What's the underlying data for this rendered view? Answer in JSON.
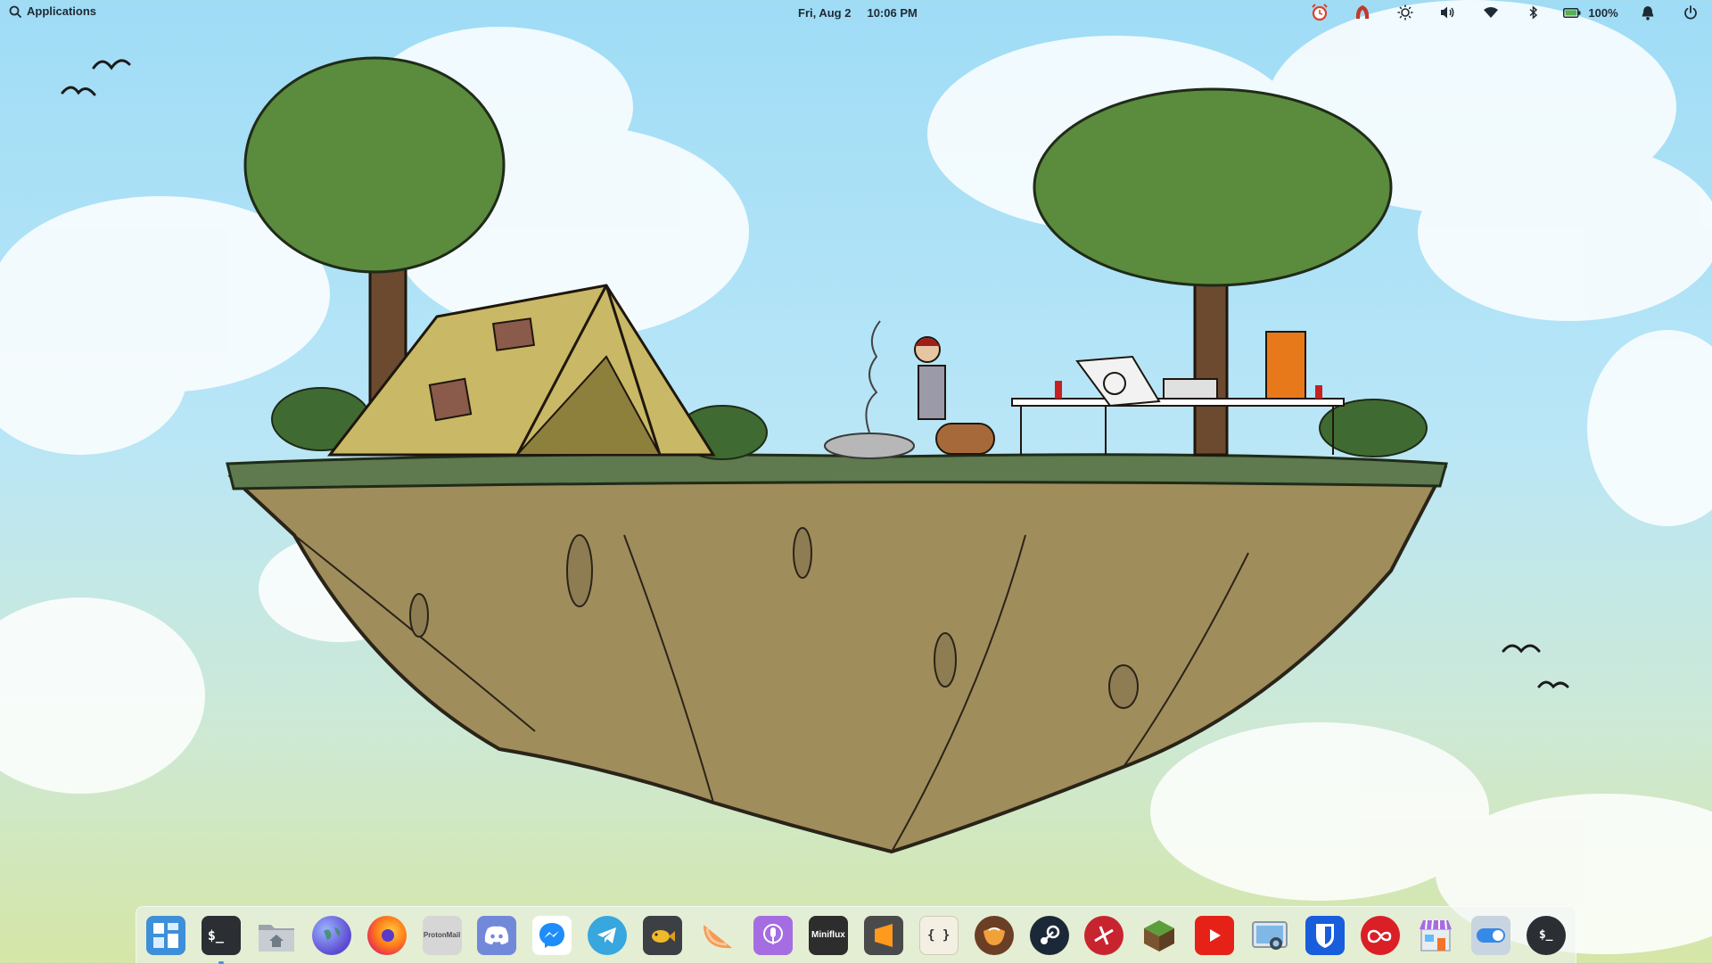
{
  "panel": {
    "applications_label": "Applications",
    "date": "Fri, Aug 2",
    "time": "10:06 PM",
    "battery_percent": "100%",
    "tray_icons": [
      "alarm-clock-icon",
      "vpn-icon",
      "brightness-icon",
      "volume-icon",
      "wifi-icon",
      "bluetooth-icon",
      "battery-icon",
      "notifications-bell-icon",
      "power-icon"
    ]
  },
  "dock": {
    "items": [
      {
        "name": "multitasking-view",
        "icon": "multitasking-icon"
      },
      {
        "name": "terminal",
        "icon": "terminal-icon",
        "label": "$_"
      },
      {
        "name": "files",
        "icon": "folder-home-icon"
      },
      {
        "name": "web-browser",
        "icon": "globe-icon"
      },
      {
        "name": "firefox",
        "icon": "firefox-icon"
      },
      {
        "name": "protonmail",
        "icon": "protonmail-icon",
        "label": "ProtonMail"
      },
      {
        "name": "discord",
        "icon": "discord-icon"
      },
      {
        "name": "messenger",
        "icon": "messenger-icon"
      },
      {
        "name": "telegram",
        "icon": "telegram-icon"
      },
      {
        "name": "podcast-fish",
        "icon": "fish-icon"
      },
      {
        "name": "melon",
        "icon": "melon-icon"
      },
      {
        "name": "podcasts",
        "icon": "podcast-icon"
      },
      {
        "name": "miniflux",
        "icon": "miniflux-icon",
        "label": "Miniflux"
      },
      {
        "name": "sublime-text",
        "icon": "sublime-icon"
      },
      {
        "name": "code-editor",
        "icon": "braces-icon",
        "label": "{ }"
      },
      {
        "name": "cafe",
        "icon": "coffee-icon"
      },
      {
        "name": "steam",
        "icon": "steam-icon"
      },
      {
        "name": "vocal",
        "icon": "vocal-icon"
      },
      {
        "name": "minecraft",
        "icon": "grass-block-icon"
      },
      {
        "name": "youtube",
        "icon": "youtube-icon"
      },
      {
        "name": "screenshot",
        "icon": "screenshot-icon"
      },
      {
        "name": "bitwarden",
        "icon": "shield-icon"
      },
      {
        "name": "creative-cloud",
        "icon": "creative-cloud-icon"
      },
      {
        "name": "appcenter",
        "icon": "store-icon"
      },
      {
        "name": "system-settings",
        "icon": "toggle-icon"
      },
      {
        "name": "terminal-alt",
        "icon": "terminal-face-icon",
        "label": "$_"
      }
    ]
  },
  "colors": {
    "sky_top": "#9fdcf6",
    "sky_bottom": "#d5e6a6",
    "dock_running_indicator": "#4a90d9"
  }
}
